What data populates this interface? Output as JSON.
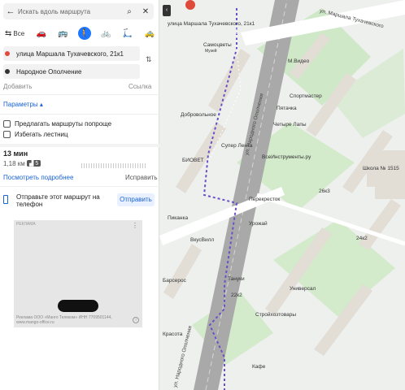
{
  "search": {
    "placeholder": "Искать вдоль маршрута"
  },
  "modes": [
    {
      "label": "Все",
      "icon": "route-all-icon"
    },
    {
      "label": "",
      "icon": "car-icon"
    },
    {
      "label": "",
      "icon": "bus-icon"
    },
    {
      "label": "",
      "icon": "pedestrian-icon"
    },
    {
      "label": "",
      "icon": "bicycle-icon"
    },
    {
      "label": "",
      "icon": "scooter-icon"
    },
    {
      "label": "",
      "icon": "taxi-icon"
    }
  ],
  "route": {
    "from": "улица Маршала Тухачевского, 21к1",
    "to": "Народное Ополчение",
    "add_label": "Добавить",
    "link_label": "Ссылка"
  },
  "params_label": "Параметры",
  "options": [
    "Предлагать маршруты попроще",
    "Избегать лестниц"
  ],
  "summary": {
    "time": "13 мин",
    "distance": "1,18 км",
    "steps": "5",
    "more": "Посмотреть подробнее",
    "compare": "Исправить"
  },
  "send": {
    "text": "Отправьте этот маршрут на телефон",
    "button": "Отправить"
  },
  "ad": {
    "label": "РЕКЛАМА",
    "footer": "Реклама ООО «Манго Телеком» ИНН 7709501144, www.mango-office.ru"
  },
  "map": {
    "labels": [
      "улица Маршала Тухачевского, 21к1",
      "Самоцветы",
      "Музей",
      "М.Видео",
      "Пятачка",
      "Добровольное",
      "Спортмастер",
      "Четыре Лапы",
      "Супер Лента",
      "ВсеИнструменты.ру",
      "БИОВЕТ",
      "Перекресток",
      "Пиканка",
      "ВкусВилл",
      "Урожай",
      "Тануки",
      "Барсерос",
      "Стройхозтовары",
      "Кафе",
      "Школа № 1515",
      "Красота",
      "Универсал",
      "26к3",
      "24к2",
      "22к2"
    ],
    "streets": [
      "ул. Маршала Тухачевского",
      "ул. Народного Ополчения",
      "ул. Народного Ополчения"
    ]
  }
}
